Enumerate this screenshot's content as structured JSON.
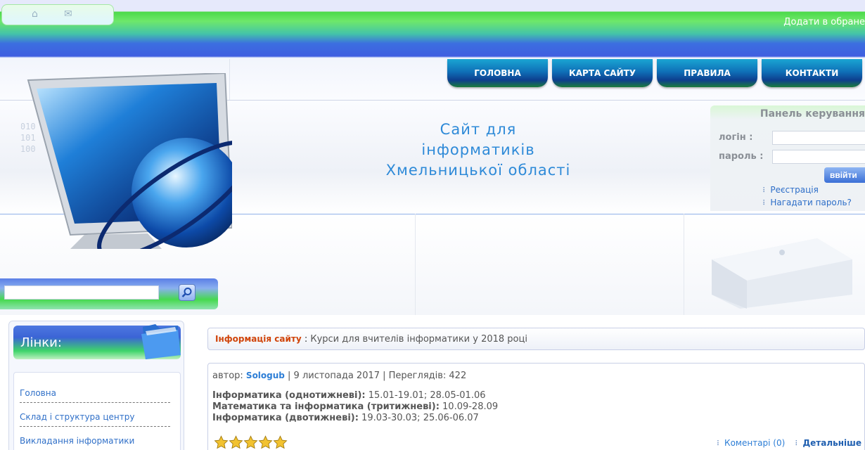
{
  "header": {
    "icons": [
      "home-icon",
      "mail-icon"
    ],
    "favorites_link": "Додати в обране"
  },
  "nav": {
    "items": [
      "ГОЛОВНА",
      "КАРТА САЙТУ",
      "ПРАВИЛА",
      "КОНТАКТИ"
    ]
  },
  "banner": {
    "title_line1": "Сайт для",
    "title_line2": "інформатиків",
    "title_line3": "Хмельницької області"
  },
  "panel": {
    "title": "Панель керування",
    "login_label": "логін :",
    "password_label": "пароль :",
    "login_value": "",
    "password_value": "",
    "enter_button": "ввійти",
    "register_link": "Реєстрація",
    "remind_link": "Нагадати пароль?"
  },
  "search": {
    "value": "",
    "button_icon": "search-icon"
  },
  "sidebar": {
    "title": "Лінки:",
    "items": [
      {
        "label": "Головна"
      },
      {
        "label": "Склад і структура центру"
      },
      {
        "label": "Викладання інформатики"
      }
    ]
  },
  "infobar": {
    "label": "Інформація сайту",
    "separator": " : ",
    "text": "Курси для вчителів інформатики у 2018 році"
  },
  "post": {
    "author_prefix": "автор: ",
    "author": "Sologub",
    "meta_rest": " | 9 листопада 2017 | Переглядів: 422",
    "lines": [
      {
        "label": "Інформатика (однотижневі):",
        "value": " 15.01-19.01; 28.05-01.06"
      },
      {
        "label": "Математика та інформатика (тритижневі):",
        "value": " 10.09-28.09"
      },
      {
        "label": "Інформатика (двотижневі):",
        "value": " 19.03-30.03; 25.06-06.07"
      }
    ],
    "rating": 5,
    "comments_link": "Коментарі (0)",
    "details_link": "Детальніше"
  },
  "colors": {
    "accent_blue": "#2e8ad8",
    "link_blue": "#3070c8",
    "info_red": "#d0440a",
    "nav_dark": "#0d3f8e"
  }
}
